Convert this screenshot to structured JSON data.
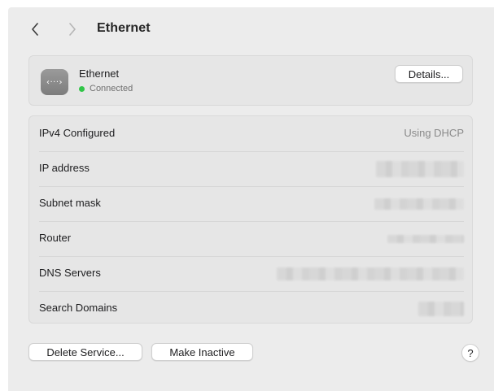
{
  "toolbar": {
    "back_icon": "chevron-left-icon",
    "forward_icon": "chevron-right-icon",
    "title": "Ethernet"
  },
  "service": {
    "icon": "ethernet-icon",
    "icon_glyph": "‹···›",
    "name": "Ethernet",
    "status": "Connected",
    "status_color": "#30c548",
    "details_label": "Details..."
  },
  "info_rows": [
    {
      "label": "IPv4 Configured",
      "value": "Using DHCP"
    },
    {
      "label": "IP address",
      "value": ""
    },
    {
      "label": "Subnet mask",
      "value": ""
    },
    {
      "label": "Router",
      "value": ""
    },
    {
      "label": "DNS Servers",
      "value": ""
    },
    {
      "label": "Search Domains",
      "value": ""
    }
  ],
  "footer": {
    "delete_label": "Delete Service...",
    "inactive_label": "Make Inactive",
    "help_label": "?"
  }
}
